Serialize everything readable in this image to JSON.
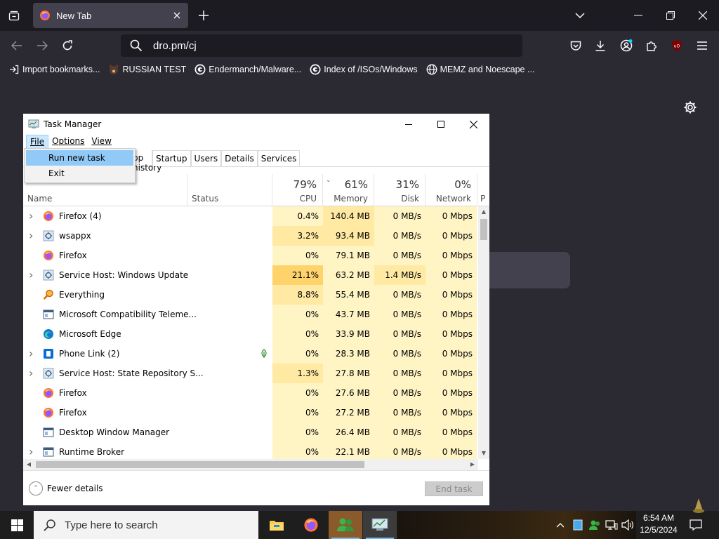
{
  "browser": {
    "tab_title": "New Tab",
    "url": "dro.pm/cj",
    "bookmarks": [
      {
        "label": "Import bookmarks...",
        "icon": "import-icon"
      },
      {
        "label": "RUSSIAN TEST",
        "icon": "bear-icon"
      },
      {
        "label": "Endermanch/Malware...",
        "icon": "github-icon"
      },
      {
        "label": "Index of /ISOs/Windows",
        "icon": "globe-g-icon"
      },
      {
        "label": "MEMZ and Noescape ...",
        "icon": "globe-icon"
      }
    ],
    "colors": {
      "frame": "#1c1b22",
      "toolbar": "#2b2a33",
      "tab": "#42414d",
      "urlbar": "#1c1b22"
    }
  },
  "task_manager": {
    "title": "Task Manager",
    "menus": [
      "File",
      "Options",
      "View"
    ],
    "menu_mnemonics": [
      "F",
      "O",
      "V"
    ],
    "file_menu": {
      "items": [
        {
          "label": "Run new task",
          "highlighted": true
        },
        {
          "label": "Exit",
          "highlighted": false
        }
      ]
    },
    "tabs": [
      "pp history",
      "Startup",
      "Users",
      "Details",
      "Services"
    ],
    "columns": {
      "name": "Name",
      "status": "Status",
      "cpu": {
        "percent": "79%",
        "label": "CPU"
      },
      "memory": {
        "percent": "61%",
        "label": "Memory"
      },
      "disk": {
        "percent": "31%",
        "label": "Disk"
      },
      "network": {
        "percent": "0%",
        "label": "Network"
      },
      "power": "P"
    },
    "processes": [
      {
        "name": "Firefox (4)",
        "icon": "firefox-icon",
        "expandable": true,
        "status_leaf": false,
        "cpu": "0.4%",
        "memory": "140.4 MB",
        "disk": "0 MB/s",
        "network": "0 Mbps",
        "cpu_heat": "#fff4c4"
      },
      {
        "name": "wsappx",
        "icon": "gear-process-icon",
        "expandable": true,
        "status_leaf": false,
        "cpu": "3.2%",
        "memory": "93.4 MB",
        "disk": "0 MB/s",
        "network": "0 Mbps",
        "cpu_heat": "#ffe9a3"
      },
      {
        "name": "Firefox",
        "icon": "firefox-icon",
        "expandable": false,
        "status_leaf": false,
        "cpu": "0%",
        "memory": "79.1 MB",
        "disk": "0 MB/s",
        "network": "0 Mbps",
        "cpu_heat": "#fff4c4"
      },
      {
        "name": "Service Host: Windows Update",
        "icon": "gear-process-icon",
        "expandable": true,
        "status_leaf": false,
        "cpu": "21.1%",
        "memory": "63.2 MB",
        "disk": "1.4 MB/s",
        "network": "0 Mbps",
        "cpu_heat": "#ffd36b"
      },
      {
        "name": "Everything",
        "icon": "magnifier-icon",
        "expandable": false,
        "status_leaf": false,
        "cpu": "8.8%",
        "memory": "55.4 MB",
        "disk": "0 MB/s",
        "network": "0 Mbps",
        "cpu_heat": "#ffe9a3"
      },
      {
        "name": "Microsoft Compatibility Teleme...",
        "icon": "window-process-icon",
        "expandable": false,
        "status_leaf": false,
        "cpu": "0%",
        "memory": "43.7 MB",
        "disk": "0 MB/s",
        "network": "0 Mbps",
        "cpu_heat": "#fff4c4"
      },
      {
        "name": "Microsoft Edge",
        "icon": "edge-icon",
        "expandable": false,
        "status_leaf": false,
        "cpu": "0%",
        "memory": "33.9 MB",
        "disk": "0 MB/s",
        "network": "0 Mbps",
        "cpu_heat": "#fff4c4"
      },
      {
        "name": "Phone Link (2)",
        "icon": "phone-link-icon",
        "expandable": true,
        "status_leaf": true,
        "cpu": "0%",
        "memory": "28.3 MB",
        "disk": "0 MB/s",
        "network": "0 Mbps",
        "cpu_heat": "#fff4c4"
      },
      {
        "name": "Service Host: State Repository S...",
        "icon": "gear-process-icon",
        "expandable": true,
        "status_leaf": false,
        "cpu": "1.3%",
        "memory": "27.8 MB",
        "disk": "0 MB/s",
        "network": "0 Mbps",
        "cpu_heat": "#ffe9a3"
      },
      {
        "name": "Firefox",
        "icon": "firefox-icon",
        "expandable": false,
        "status_leaf": false,
        "cpu": "0%",
        "memory": "27.6 MB",
        "disk": "0 MB/s",
        "network": "0 Mbps",
        "cpu_heat": "#fff4c4"
      },
      {
        "name": "Firefox",
        "icon": "firefox-icon",
        "expandable": false,
        "status_leaf": false,
        "cpu": "0%",
        "memory": "27.2 MB",
        "disk": "0 MB/s",
        "network": "0 Mbps",
        "cpu_heat": "#fff4c4"
      },
      {
        "name": "Desktop Window Manager",
        "icon": "window-process-icon",
        "expandable": false,
        "status_leaf": false,
        "cpu": "0%",
        "memory": "26.4 MB",
        "disk": "0 MB/s",
        "network": "0 Mbps",
        "cpu_heat": "#fff4c4"
      },
      {
        "name": "Runtime Broker",
        "icon": "window-process-icon",
        "expandable": true,
        "status_leaf": false,
        "cpu": "0%",
        "memory": "22.1 MB",
        "disk": "0 MB/s",
        "network": "0 Mbps",
        "cpu_heat": "#fff4c4"
      }
    ],
    "fewer_details": "Fewer details",
    "end_task": "End task",
    "colors": {
      "menu_highlight": "#91c9f7",
      "cell_base": "#fff4c4",
      "cell_mid": "#ffe9a3",
      "cell_hot": "#ffd36b"
    }
  },
  "taskbar": {
    "search_placeholder": "Type here to search",
    "time": "6:54 AM",
    "date": "12/5/2024",
    "apps": [
      {
        "icon": "file-explorer-icon",
        "active": false
      },
      {
        "icon": "firefox-icon",
        "active": false
      },
      {
        "icon": "users-app-icon",
        "active": true
      },
      {
        "icon": "task-manager-icon",
        "active": true
      }
    ]
  }
}
